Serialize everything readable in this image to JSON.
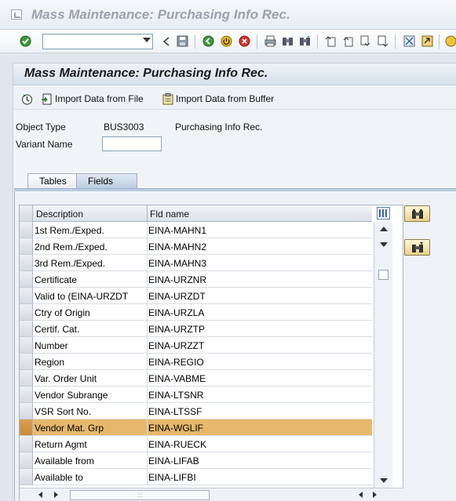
{
  "window": {
    "title": "Mass Maintenance: Purchasing Info Rec."
  },
  "toolbar": {
    "command_value": "",
    "icons": [
      "enter-icon",
      "back-icon",
      "save-icon",
      "back-green-icon",
      "exit-icon",
      "cancel-icon",
      "print-icon",
      "find-icon",
      "find-next-icon",
      "first-page-icon",
      "prev-page-icon",
      "next-page-icon",
      "last-page-icon",
      "new-session-icon",
      "shortcut-icon",
      "help-icon"
    ]
  },
  "page": {
    "title": "Mass Maintenance: Purchasing Info Rec.",
    "buttons": {
      "execute": "",
      "import_file": "Import Data from File",
      "import_buffer": "Import Data from Buffer"
    }
  },
  "form": {
    "object_type_label": "Object Type",
    "object_type_value": "BUS3003",
    "object_type_desc": "Purchasing Info Rec.",
    "variant_label": "Variant Name",
    "variant_value": ""
  },
  "tabs": [
    {
      "label": "Tables",
      "active": false
    },
    {
      "label": "Fields",
      "active": true
    }
  ],
  "grid": {
    "columns": [
      "Description",
      "Fld name"
    ],
    "rows": [
      {
        "description": "1st Rem./Exped.",
        "field": "EINA-MAHN1",
        "selected": false
      },
      {
        "description": "2nd Rem./Exped.",
        "field": "EINA-MAHN2",
        "selected": false
      },
      {
        "description": "3rd Rem./Exped.",
        "field": "EINA-MAHN3",
        "selected": false
      },
      {
        "description": "Certificate",
        "field": "EINA-URZNR",
        "selected": false
      },
      {
        "description": "Valid to (EINA-URZDT",
        "field": "EINA-URZDT",
        "selected": false
      },
      {
        "description": "Ctry of Origin",
        "field": "EINA-URZLA",
        "selected": false
      },
      {
        "description": "Certif. Cat.",
        "field": "EINA-URZTP",
        "selected": false
      },
      {
        "description": "Number",
        "field": "EINA-URZZT",
        "selected": false
      },
      {
        "description": "Region",
        "field": "EINA-REGIO",
        "selected": false
      },
      {
        "description": "Var. Order Unit",
        "field": "EINA-VABME",
        "selected": false
      },
      {
        "description": "Vendor Subrange",
        "field": "EINA-LTSNR",
        "selected": false
      },
      {
        "description": "VSR Sort No.",
        "field": "EINA-LTSSF",
        "selected": false
      },
      {
        "description": "Vendor Mat. Grp",
        "field": "EINA-WGLIF",
        "selected": true
      },
      {
        "description": "Return Agmt",
        "field": "EINA-RUECK",
        "selected": false
      },
      {
        "description": "Available from",
        "field": "EINA-LIFAB",
        "selected": false
      },
      {
        "description": "Available to",
        "field": "EINA-LIFBI",
        "selected": false
      }
    ]
  },
  "colors": {
    "selected_row": "#e7b86b",
    "header_band": "#d6e0ea",
    "tab_active": "#b9cce0"
  }
}
